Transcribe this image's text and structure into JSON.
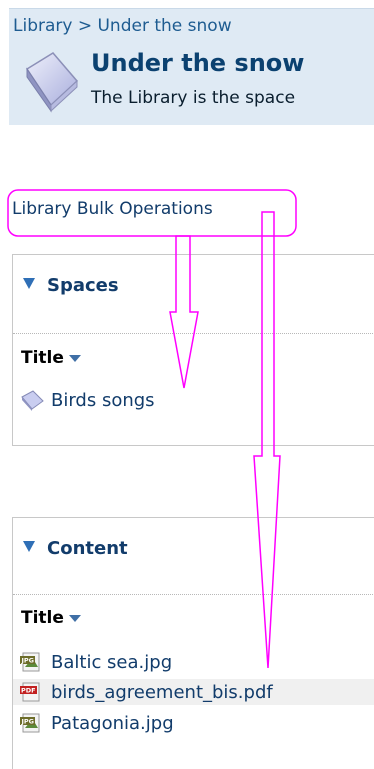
{
  "header": {
    "breadcrumb": "Library > Under the snow",
    "title": "Under the snow",
    "description": "The Library is the space"
  },
  "bulk_operations_label": "Library Bulk Operations",
  "spaces_panel": {
    "heading": "Spaces",
    "column_title": "Title",
    "items": [
      {
        "label": "Birds songs",
        "icon": "folder-space-icon"
      }
    ]
  },
  "content_panel": {
    "heading": "Content",
    "column_title": "Title",
    "items": [
      {
        "label": "Baltic sea.jpg",
        "icon": "jpg-file-icon"
      },
      {
        "label": "birds_agreement_bis.pdf",
        "icon": "pdf-file-icon"
      },
      {
        "label": "Patagonia.jpg",
        "icon": "jpg-file-icon"
      }
    ]
  },
  "colors": {
    "header_bg": "#dfeaf4",
    "link": "#123c6b",
    "title": "#0b4170",
    "annotation": "#ff00ff"
  }
}
